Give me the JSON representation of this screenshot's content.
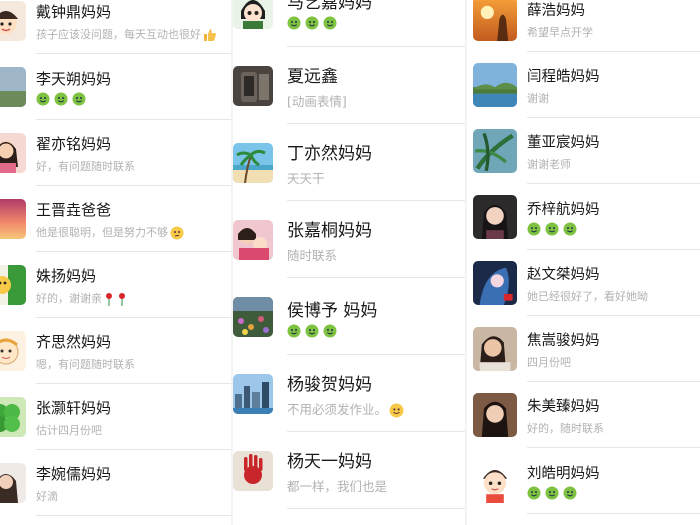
{
  "columns": [
    {
      "contacts": [
        {
          "name": "戴钟鼎妈妈",
          "message": "孩子应该没问题，每天互动也很好",
          "emoji": "thumbs-up-emoji",
          "avatar": "cartoon-child"
        },
        {
          "name": "李天朔妈妈",
          "message": "",
          "emoji": "smile-row-emoji",
          "avatar": "landscape-flag"
        },
        {
          "name": "翟亦铭妈妈",
          "message": "好，有问题随时联系",
          "avatar": "portrait-woman"
        },
        {
          "name": "王晋垚爸爸",
          "message": "他是很聪明，但是努力不够",
          "emoji": "thinking-emoji",
          "avatar": "sunset"
        },
        {
          "name": "姝扬妈妈",
          "message": "好的，谢谢亲",
          "emoji": "rose-emoji",
          "avatar": "green-cartoon"
        },
        {
          "name": "齐思然妈妈",
          "message": "嗯，有问题随时联系",
          "avatar": "cartoon-face"
        },
        {
          "name": "张灏轩妈妈",
          "message": "估计四月份吧",
          "avatar": "green-clover"
        },
        {
          "name": "李婉儒妈妈",
          "message": "好滴",
          "avatar": "portrait-woman-2"
        }
      ]
    },
    {
      "contacts": [
        {
          "name": "马艺嘉妈妈",
          "message": "",
          "emoji": "smile-row-emoji",
          "avatar": "anime-girl"
        },
        {
          "name": "夏远鑫",
          "message": "[动画表情]",
          "avatar": "dark-photo"
        },
        {
          "name": "丁亦然妈妈",
          "message": "天天干",
          "avatar": "beach-palm"
        },
        {
          "name": "张嘉桐妈妈",
          "message": "随时联系",
          "avatar": "mother-child"
        },
        {
          "name": "侯博予 妈妈",
          "message": "",
          "emoji": "smile-row-emoji",
          "avatar": "flower-field"
        },
        {
          "name": "杨骏贺妈妈",
          "message": "不用必须发作业。",
          "emoji": "smile-emoji",
          "avatar": "city-skyline"
        },
        {
          "name": "杨天一妈妈",
          "message": "都一样，我们也是",
          "avatar": "red-handprint"
        }
      ]
    },
    {
      "contacts": [
        {
          "name": "薛浩妈妈",
          "message": "希望早点开学",
          "avatar": "sunset-silhouette"
        },
        {
          "name": "闫程皓妈妈",
          "message": "谢谢",
          "avatar": "lake-view"
        },
        {
          "name": "董亚宸妈妈",
          "message": "谢谢老师",
          "avatar": "palm-leaves"
        },
        {
          "name": "乔梓航妈妈",
          "message": "",
          "emoji": "smile-row-emoji",
          "avatar": "portrait-woman-3"
        },
        {
          "name": "赵文桀妈妈",
          "message": "她已经很好了，看好她呦",
          "avatar": "anime-art"
        },
        {
          "name": "焦嵩骏妈妈",
          "message": "四月份吧",
          "avatar": "portrait-woman-4"
        },
        {
          "name": "朱美臻妈妈",
          "message": "好的，随时联系",
          "avatar": "portrait-woman-5"
        },
        {
          "name": "刘皓明妈妈",
          "message": "",
          "emoji": "smile-row-emoji",
          "avatar": "cartoon-boy"
        }
      ]
    }
  ],
  "colors": {
    "name": "#191919",
    "message": "#b2b2b2",
    "divider": "#e6e6e6",
    "smile_emoji": "#7dc241"
  }
}
